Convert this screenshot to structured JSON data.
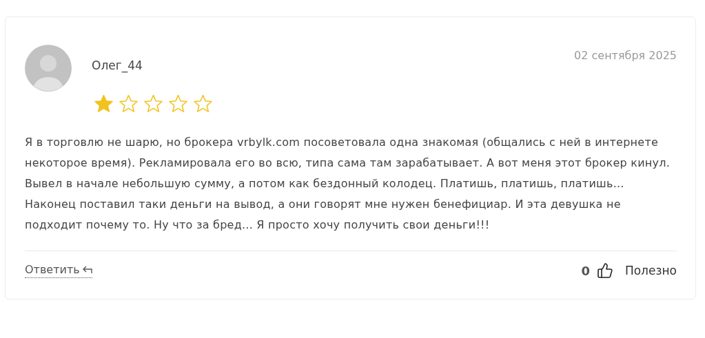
{
  "review": {
    "author": "Олег_44",
    "date": "02 сентября 2025",
    "stars": 1,
    "text": "Я в торговлю не шарю, но брокера vrbylk.com посоветовала одна знакомая (общались с ней в интернете некоторое время). Рекламировала его во всю, типа сама там зарабатывает. А вот меня этот брокер кинул. Вывел в начале небольшую сумму, а потом как бездонный колодец. Платишь, платишь, платишь... Наконец поставил таки деньги на вывод, а они говорят мне нужен бенефициар. И эта девушка не подходит почему то. Ну что за бред... Я просто хочу получить свои деньги!!!",
    "reply_label": "Ответить",
    "likes": "0",
    "helpful_label": "Полезно"
  }
}
